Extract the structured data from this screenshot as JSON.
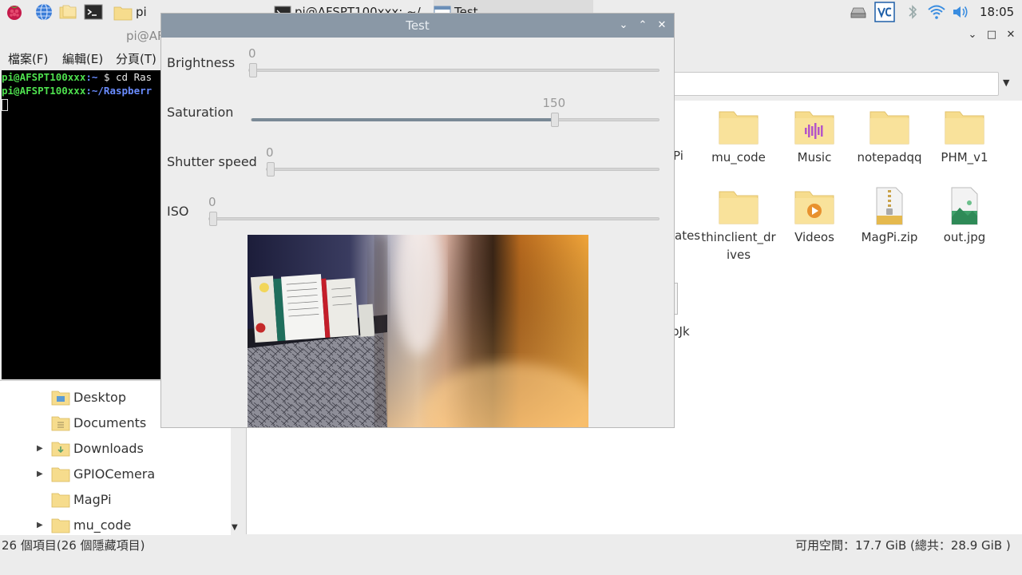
{
  "taskbar": {
    "tasks": [
      {
        "label": "pi"
      },
      {
        "label": "pi@AFSPT100xxx: ~/"
      },
      {
        "label": "Test"
      }
    ],
    "clock": "18:05",
    "icons": [
      "raspberry-menu-icon",
      "web-browser-icon",
      "file-manager-icon",
      "terminal-icon",
      "cpu-monitor-icon",
      "vnc-icon",
      "bluetooth-icon",
      "wifi-icon",
      "volume-icon"
    ]
  },
  "terminal": {
    "title": "pi@AF",
    "menu": [
      "檔案(F)",
      "編輯(E)",
      "分頁(T)"
    ],
    "lines": [
      {
        "user": "pi@AFSPT100xxx",
        "path": ":~",
        "rest": " $ cd Ras"
      },
      {
        "user": "pi@AFSPT100xxx",
        "path": ":~/Raspberr",
        "rest": ""
      }
    ]
  },
  "file_manager": {
    "items": [
      {
        "label": "Pi",
        "icon": "folder-icon"
      },
      {
        "label": "mu_code",
        "icon": "folder-icon"
      },
      {
        "label": "Music",
        "icon": "music-folder-icon"
      },
      {
        "label": "notepadqq",
        "icon": "folder-icon"
      },
      {
        "label": "PHM_v1",
        "icon": "folder-icon"
      },
      {
        "label": "ates",
        "icon": "folder-icon"
      },
      {
        "label": "thinclient_drives",
        "icon": "folder-icon"
      },
      {
        "label": "Videos",
        "icon": "videos-folder-icon"
      },
      {
        "label": "MagPi.zip",
        "icon": "zip-file-icon"
      },
      {
        "label": "out.jpg",
        "icon": "image-file-icon"
      },
      {
        "label": "bJk",
        "icon": "file-icon"
      }
    ],
    "sidebar": [
      {
        "label": "Desktop",
        "expandable": false
      },
      {
        "label": "Documents",
        "expandable": false
      },
      {
        "label": "Downloads",
        "expandable": true
      },
      {
        "label": "GPIOCemera",
        "expandable": true
      },
      {
        "label": "MagPi",
        "expandable": false
      },
      {
        "label": "mu_code",
        "expandable": true
      }
    ],
    "status_left": "26 個項目(26 個隱藏項目)",
    "status_right": "可用空間：17.7 GiB (總共：28.9 GiB )"
  },
  "dialog": {
    "title": "Test",
    "sliders": [
      {
        "label": "Brightness",
        "value": "0",
        "fraction": 0.0
      },
      {
        "label": "Saturation",
        "value": "150",
        "fraction": 0.75
      },
      {
        "label": "Shutter speed",
        "value": "0",
        "fraction": 0.0
      },
      {
        "label": "ISO",
        "value": "0",
        "fraction": 0.0
      }
    ]
  },
  "colors": {
    "dialog_titlebar": "#8a98a6",
    "folder": "#f6dc8d",
    "terminal_bg": "#000000",
    "terminal_user": "#4ee04e",
    "terminal_path": "#6a8cff"
  }
}
